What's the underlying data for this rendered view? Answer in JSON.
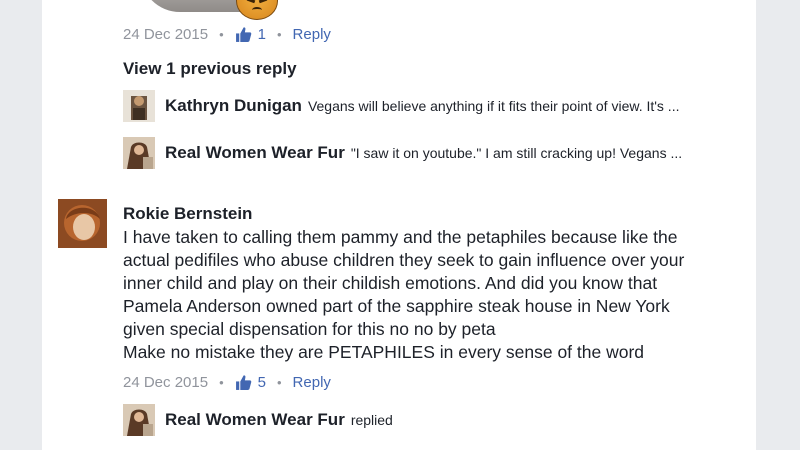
{
  "previous_comment": {
    "date": "24 Dec 2015",
    "likes": "1",
    "reply_label": "Reply"
  },
  "view_previous": "View 1 previous reply",
  "replies": [
    {
      "name": "Kathryn Dunigan",
      "text": "Vegans will believe anything if it fits their point of view.  It's ..."
    },
    {
      "name": "Real Women Wear Fur",
      "text": "\"I saw it on youtube.\"  I am still cracking up!  Vegans ..."
    }
  ],
  "comment": {
    "author": "Rokie Bernstein",
    "lines": [
      "I have taken to calling them pammy and the petaphiles because like the",
      "actual pedifiles who abuse children they seek to gain influence over your",
      "inner child and play on their childish emotions. And did you know that",
      "Pamela Anderson owned part of the sapphire steak house in New York",
      "given special dispensation for this no no by peta",
      "Make no mistake they are PETAPHILES in every sense of the word"
    ],
    "date": "24 Dec 2015",
    "likes": "5",
    "reply_label": "Reply"
  },
  "bottom_reply": {
    "name": "Real Women Wear Fur",
    "text": "replied"
  },
  "separator": "•",
  "icons": {
    "like": "thumbs-up-icon",
    "emoji": "angry-face-icon"
  },
  "colors": {
    "link": "#4267b2",
    "meta": "#90949c",
    "text": "#1d2129",
    "background": "#e9ebee"
  }
}
